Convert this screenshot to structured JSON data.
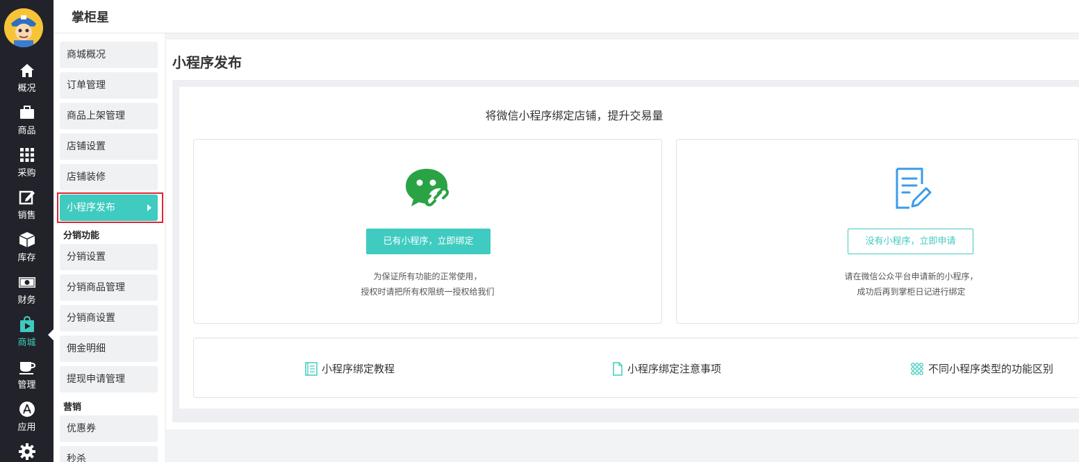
{
  "app": {
    "title": "掌柜星"
  },
  "rail": {
    "items": [
      {
        "label": "概况",
        "icon": "home-icon"
      },
      {
        "label": "商品",
        "icon": "briefcase-icon"
      },
      {
        "label": "采购",
        "icon": "grid-icon"
      },
      {
        "label": "销售",
        "icon": "edit-icon"
      },
      {
        "label": "库存",
        "icon": "cube-icon"
      },
      {
        "label": "财务",
        "icon": "money-icon"
      },
      {
        "label": "商城",
        "icon": "shop-bag-icon",
        "active": true
      },
      {
        "label": "管理",
        "icon": "cup-icon"
      },
      {
        "label": "应用",
        "icon": "app-store-icon"
      },
      {
        "label": "",
        "icon": "gear-icon"
      }
    ]
  },
  "subnav": {
    "items": [
      "商城概况",
      "订单管理",
      "商品上架管理",
      "店铺设置",
      "店铺装修",
      "小程序发布"
    ],
    "active_item": "小程序发布",
    "section_fenxiao": "分销功能",
    "fenxiao_items": [
      "分销设置",
      "分销商品管理",
      "分销商设置",
      "佣金明细",
      "提现申请管理"
    ],
    "section_marketing": "营销",
    "marketing_items": [
      "优惠券",
      "秒杀"
    ]
  },
  "main": {
    "page_title": "小程序发布",
    "heading": "将微信小程序绑定店铺，提升交易量",
    "card_bind": {
      "button": "已有小程序，立即绑定",
      "note_line1": "为保证所有功能的正常使用，",
      "note_line2": "授权时请把所有权限统一授权给我们"
    },
    "card_apply": {
      "button": "没有小程序，立即申请",
      "note_line1": "请在微信公众平台申请新的小程序，",
      "note_line2": "成功后再到掌柜日记进行绑定"
    },
    "links": [
      {
        "label": "小程序绑定教程",
        "icon": "list-doc-icon"
      },
      {
        "label": "小程序绑定注意事项",
        "icon": "file-icon"
      },
      {
        "label": "不同小程序类型的功能区别",
        "icon": "dots-grid-icon"
      }
    ]
  },
  "colors": {
    "accent": "#3fcbc0",
    "rail_bg": "#22232a",
    "wechat_green": "#2aa345",
    "doc_blue": "#3b9be8",
    "highlight_red": "#e2232f"
  }
}
